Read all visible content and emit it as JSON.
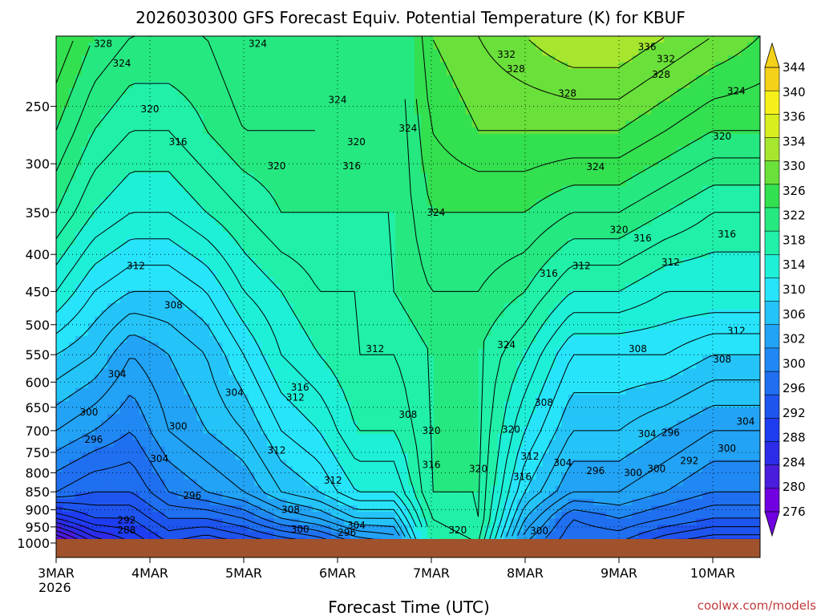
{
  "chart_data": {
    "type": "heatmap",
    "title": "2026030300 GFS Forecast Equiv. Potential Temperature (K) for KBUF",
    "xlabel": "Forecast Time (UTC)",
    "ylabel": "",
    "x_ticks": [
      {
        "day": 0,
        "label": "3MAR"
      },
      {
        "day": 1,
        "label": "4MAR"
      },
      {
        "day": 2,
        "label": "5MAR"
      },
      {
        "day": 3,
        "label": "6MAR"
      },
      {
        "day": 4,
        "label": "7MAR"
      },
      {
        "day": 5,
        "label": "8MAR"
      },
      {
        "day": 6,
        "label": "9MAR"
      },
      {
        "day": 7,
        "label": "10MAR"
      }
    ],
    "x_sublabel": "2026",
    "xlim_days": [
      0,
      7.5
    ],
    "y_ticks": [
      250,
      300,
      350,
      400,
      450,
      500,
      550,
      600,
      650,
      700,
      750,
      800,
      850,
      900,
      950,
      1000
    ],
    "ylim_hPa": [
      1000,
      200
    ],
    "y_scale": "log-pressure",
    "grid": true,
    "colorbar": {
      "unit": "K",
      "levels": [
        276,
        280,
        284,
        288,
        292,
        296,
        300,
        302,
        306,
        310,
        314,
        318,
        322,
        326,
        330,
        334,
        336,
        340,
        344
      ],
      "colors": [
        "#7000e0",
        "#4a1cdc",
        "#2c2ce8",
        "#1e3cf0",
        "#1e55ee",
        "#1f6ff0",
        "#2088f2",
        "#22a3f5",
        "#24c4f8",
        "#27e4fb",
        "#1ef0d8",
        "#20f0a8",
        "#25e880",
        "#33e050",
        "#6ae03a",
        "#a6e62e",
        "#d8ee1e",
        "#f5f01a",
        "#f5d21a"
      ],
      "labels": [
        "344",
        "340",
        "336",
        "334",
        "330",
        "326",
        "322",
        "318",
        "314",
        "310",
        "306",
        "302",
        "300",
        "296",
        "292",
        "288",
        "284",
        "280",
        "276"
      ]
    },
    "profiles": [
      {
        "day": 0.0,
        "temps": [
          276,
          288,
          298,
          304,
          310,
          316,
          322,
          326,
          330
        ]
      },
      {
        "day": 0.4,
        "temps": [
          284,
          292,
          296,
          302,
          308,
          312,
          318,
          322,
          326
        ]
      },
      {
        "day": 0.8,
        "temps": [
          288,
          292,
          296,
          300,
          304,
          310,
          316,
          320,
          324
        ]
      },
      {
        "day": 1.2,
        "temps": [
          292,
          296,
          300,
          304,
          306,
          310,
          316,
          320,
          324
        ]
      },
      {
        "day": 1.6,
        "temps": [
          290,
          296,
          302,
          306,
          308,
          312,
          318,
          322,
          324
        ]
      },
      {
        "day": 2.0,
        "temps": [
          292,
          298,
          304,
          308,
          312,
          316,
          320,
          324,
          326
        ]
      },
      {
        "day": 2.4,
        "temps": [
          294,
          302,
          308,
          312,
          316,
          318,
          322,
          324,
          326
        ]
      },
      {
        "day": 2.8,
        "temps": [
          296,
          304,
          310,
          314,
          318,
          320,
          322,
          324,
          324
        ]
      },
      {
        "day": 3.2,
        "temps": [
          300,
          308,
          314,
          318,
          320,
          320,
          322,
          322,
          322
        ]
      },
      {
        "day": 3.6,
        "temps": [
          302,
          308,
          314,
          318,
          320,
          322,
          322,
          322,
          322
        ]
      },
      {
        "day": 4.0,
        "temps": [
          318,
          320,
          322,
          322,
          322,
          324,
          326,
          328,
          330
        ]
      },
      {
        "day": 4.5,
        "temps": [
          320,
          322,
          322,
          322,
          322,
          324,
          326,
          330,
          332
        ]
      },
      {
        "day": 5.0,
        "temps": [
          302,
          306,
          310,
          314,
          318,
          322,
          326,
          330,
          334
        ]
      },
      {
        "day": 5.5,
        "temps": [
          296,
          298,
          304,
          308,
          312,
          318,
          324,
          330,
          336
        ]
      },
      {
        "day": 6.0,
        "temps": [
          296,
          300,
          304,
          308,
          312,
          318,
          324,
          330,
          336
        ]
      },
      {
        "day": 6.5,
        "temps": [
          292,
          298,
          302,
          306,
          312,
          316,
          322,
          328,
          334
        ]
      },
      {
        "day": 7.0,
        "temps": [
          290,
          296,
          300,
          304,
          310,
          316,
          320,
          326,
          332
        ]
      },
      {
        "day": 7.5,
        "temps": [
          290,
          296,
          300,
          304,
          310,
          316,
          320,
          326,
          330
        ]
      }
    ],
    "profile_levels_hPa": [
      1000,
      925,
      850,
      700,
      550,
      450,
      350,
      270,
      200
    ],
    "contour_labels": [
      {
        "text": "328",
        "day": 0.5,
        "p": 205
      },
      {
        "text": "324",
        "day": 0.7,
        "p": 218
      },
      {
        "text": "320",
        "day": 1.0,
        "p": 252
      },
      {
        "text": "316",
        "day": 1.3,
        "p": 280
      },
      {
        "text": "312",
        "day": 0.85,
        "p": 415
      },
      {
        "text": "308",
        "day": 1.25,
        "p": 470
      },
      {
        "text": "304",
        "day": 0.65,
        "p": 585
      },
      {
        "text": "300",
        "day": 0.35,
        "p": 660
      },
      {
        "text": "296",
        "day": 0.4,
        "p": 720
      },
      {
        "text": "292",
        "day": 0.75,
        "p": 930
      },
      {
        "text": "288",
        "day": 0.75,
        "p": 960
      },
      {
        "text": "300",
        "day": 1.3,
        "p": 690
      },
      {
        "text": "304",
        "day": 1.1,
        "p": 765
      },
      {
        "text": "296",
        "day": 1.45,
        "p": 860
      },
      {
        "text": "304",
        "day": 1.9,
        "p": 620
      },
      {
        "text": "324",
        "day": 2.15,
        "p": 205
      },
      {
        "text": "320",
        "day": 2.35,
        "p": 302
      },
      {
        "text": "316",
        "day": 2.6,
        "p": 610
      },
      {
        "text": "312",
        "day": 2.55,
        "p": 630
      },
      {
        "text": "312",
        "day": 2.35,
        "p": 745
      },
      {
        "text": "308",
        "day": 2.5,
        "p": 900
      },
      {
        "text": "312",
        "day": 2.95,
        "p": 820
      },
      {
        "text": "300",
        "day": 2.6,
        "p": 958
      },
      {
        "text": "304",
        "day": 3.2,
        "p": 945
      },
      {
        "text": "296",
        "day": 3.1,
        "p": 968
      },
      {
        "text": "324",
        "day": 3.0,
        "p": 245
      },
      {
        "text": "320",
        "day": 3.2,
        "p": 280
      },
      {
        "text": "316",
        "day": 3.15,
        "p": 302
      },
      {
        "text": "312",
        "day": 3.4,
        "p": 540
      },
      {
        "text": "324",
        "day": 3.75,
        "p": 268
      },
      {
        "text": "324",
        "day": 4.05,
        "p": 350
      },
      {
        "text": "308",
        "day": 3.75,
        "p": 665
      },
      {
        "text": "320",
        "day": 4.0,
        "p": 700
      },
      {
        "text": "316",
        "day": 4.0,
        "p": 780
      },
      {
        "text": "320",
        "day": 4.5,
        "p": 790
      },
      {
        "text": "320",
        "day": 4.28,
        "p": 960
      },
      {
        "text": "332",
        "day": 4.8,
        "p": 212
      },
      {
        "text": "328",
        "day": 4.9,
        "p": 222
      },
      {
        "text": "328",
        "day": 5.45,
        "p": 240
      },
      {
        "text": "324",
        "day": 5.75,
        "p": 303
      },
      {
        "text": "316",
        "day": 5.25,
        "p": 425
      },
      {
        "text": "312",
        "day": 5.6,
        "p": 415
      },
      {
        "text": "324",
        "day": 4.8,
        "p": 533
      },
      {
        "text": "320",
        "day": 4.85,
        "p": 697
      },
      {
        "text": "308",
        "day": 5.2,
        "p": 640
      },
      {
        "text": "312",
        "day": 5.05,
        "p": 760
      },
      {
        "text": "316",
        "day": 4.97,
        "p": 810
      },
      {
        "text": "300",
        "day": 5.15,
        "p": 963
      },
      {
        "text": "304",
        "day": 5.4,
        "p": 775
      },
      {
        "text": "296",
        "day": 5.75,
        "p": 795
      },
      {
        "text": "300",
        "day": 6.15,
        "p": 800
      },
      {
        "text": "300",
        "day": 6.4,
        "p": 790
      },
      {
        "text": "304",
        "day": 6.3,
        "p": 707
      },
      {
        "text": "296",
        "day": 6.55,
        "p": 705
      },
      {
        "text": "292",
        "day": 6.75,
        "p": 770
      },
      {
        "text": "300",
        "day": 7.15,
        "p": 740
      },
      {
        "text": "304",
        "day": 7.35,
        "p": 680
      },
      {
        "text": "308",
        "day": 7.1,
        "p": 558
      },
      {
        "text": "308",
        "day": 6.2,
        "p": 540
      },
      {
        "text": "312",
        "day": 7.25,
        "p": 510
      },
      {
        "text": "312",
        "day": 6.55,
        "p": 410
      },
      {
        "text": "316",
        "day": 6.25,
        "p": 380
      },
      {
        "text": "320",
        "day": 6.0,
        "p": 370
      },
      {
        "text": "316",
        "day": 7.15,
        "p": 375
      },
      {
        "text": "320",
        "day": 7.1,
        "p": 275
      },
      {
        "text": "324",
        "day": 7.25,
        "p": 238
      },
      {
        "text": "328",
        "day": 6.45,
        "p": 226
      },
      {
        "text": "332",
        "day": 6.5,
        "p": 215
      },
      {
        "text": "336",
        "day": 6.3,
        "p": 207
      }
    ]
  },
  "watermark": "coolwx.com/models"
}
